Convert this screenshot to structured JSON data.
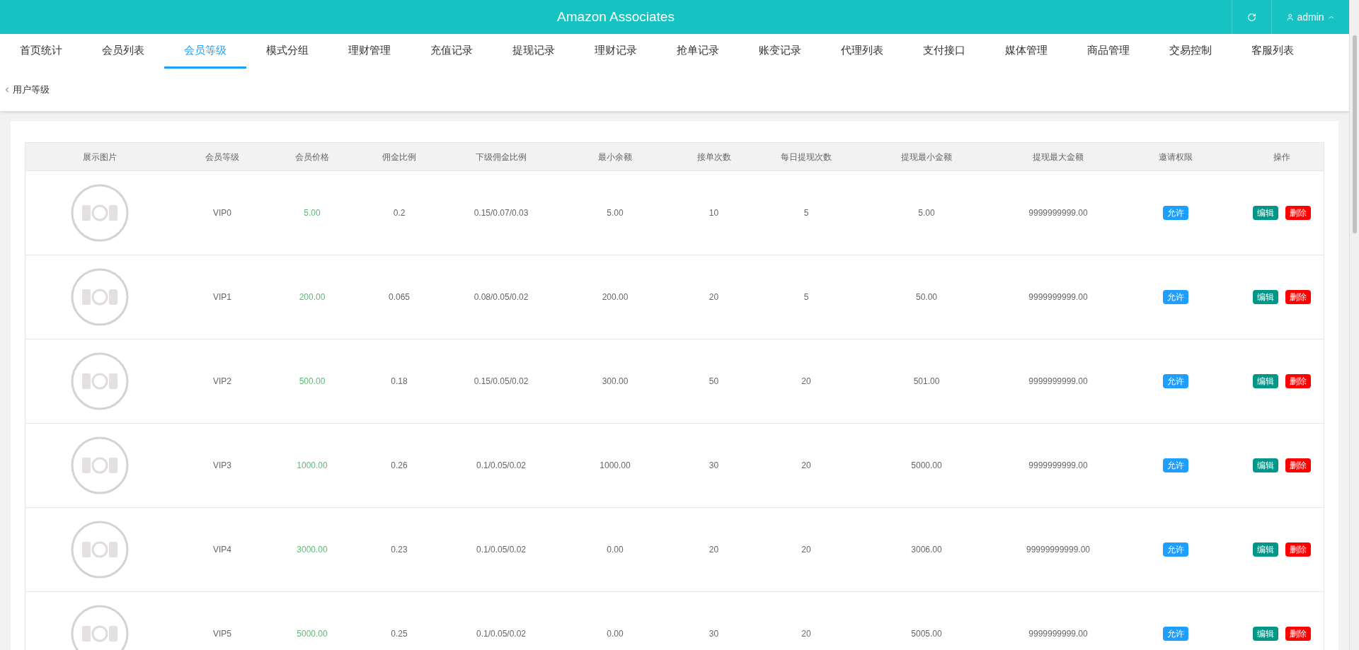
{
  "header": {
    "title": "Amazon Associates",
    "user": {
      "name": "admin",
      "menu_open": true
    }
  },
  "tabs": [
    {
      "label": "首页统计",
      "selected": false
    },
    {
      "label": "会员列表",
      "selected": false
    },
    {
      "label": "会员等级",
      "selected": true
    },
    {
      "label": "模式分组",
      "selected": false
    },
    {
      "label": "理财管理",
      "selected": false
    },
    {
      "label": "充值记录",
      "selected": false
    },
    {
      "label": "提现记录",
      "selected": false
    },
    {
      "label": "理财记录",
      "selected": false
    },
    {
      "label": "抢单记录",
      "selected": false
    },
    {
      "label": "账变记录",
      "selected": false
    },
    {
      "label": "代理列表",
      "selected": false
    },
    {
      "label": "支付接口",
      "selected": false
    },
    {
      "label": "媒体管理",
      "selected": false
    },
    {
      "label": "商品管理",
      "selected": false
    },
    {
      "label": "交易控制",
      "selected": false
    },
    {
      "label": "客服列表",
      "selected": false
    }
  ],
  "breadcrumb": "用户等级",
  "table": {
    "columns": [
      "展示图片",
      "会员等级",
      "会员价格",
      "佣金比例",
      "下级佣金比例",
      "最小余额",
      "接单次数",
      "每日提现次数",
      "提现最小金额",
      "提现最大金额",
      "邀请权限",
      "操作"
    ],
    "rows": [
      {
        "level": "VIP0",
        "price": "5.00",
        "commission": "0.2",
        "sub_commission": "0.15/0.07/0.03",
        "min_balance": "5.00",
        "orders": "10",
        "daily_withdrawals": "5",
        "withdraw_min": "5.00",
        "withdraw_max": "9999999999.00",
        "invite": "允许",
        "actions": [
          "编辑",
          "删除"
        ]
      },
      {
        "level": "VIP1",
        "price": "200.00",
        "commission": "0.065",
        "sub_commission": "0.08/0.05/0.02",
        "min_balance": "200.00",
        "orders": "20",
        "daily_withdrawals": "5",
        "withdraw_min": "50.00",
        "withdraw_max": "9999999999.00",
        "invite": "允许",
        "actions": [
          "编辑",
          "删除"
        ]
      },
      {
        "level": "VIP2",
        "price": "500.00",
        "commission": "0.18",
        "sub_commission": "0.15/0.05/0.02",
        "min_balance": "300.00",
        "orders": "50",
        "daily_withdrawals": "20",
        "withdraw_min": "501.00",
        "withdraw_max": "9999999999.00",
        "invite": "允许",
        "actions": [
          "编辑",
          "删除"
        ]
      },
      {
        "level": "VIP3",
        "price": "1000.00",
        "commission": "0.26",
        "sub_commission": "0.1/0.05/0.02",
        "min_balance": "1000.00",
        "orders": "30",
        "daily_withdrawals": "20",
        "withdraw_min": "5000.00",
        "withdraw_max": "9999999999.00",
        "invite": "允许",
        "actions": [
          "编辑",
          "删除"
        ]
      },
      {
        "level": "VIP4",
        "price": "3000.00",
        "commission": "0.23",
        "sub_commission": "0.1/0.05/0.02",
        "min_balance": "0.00",
        "orders": "20",
        "daily_withdrawals": "20",
        "withdraw_min": "3006.00",
        "withdraw_max": "99999999999.00",
        "invite": "允许",
        "actions": [
          "编辑",
          "删除"
        ]
      },
      {
        "level": "VIP5",
        "price": "5000.00",
        "commission": "0.25",
        "sub_commission": "0.1/0.05/0.02",
        "min_balance": "0.00",
        "orders": "30",
        "daily_withdrawals": "20",
        "withdraw_min": "5005.00",
        "withdraw_max": "9999999999.00",
        "invite": "允许",
        "actions": [
          "编辑",
          "删除"
        ]
      }
    ]
  }
}
